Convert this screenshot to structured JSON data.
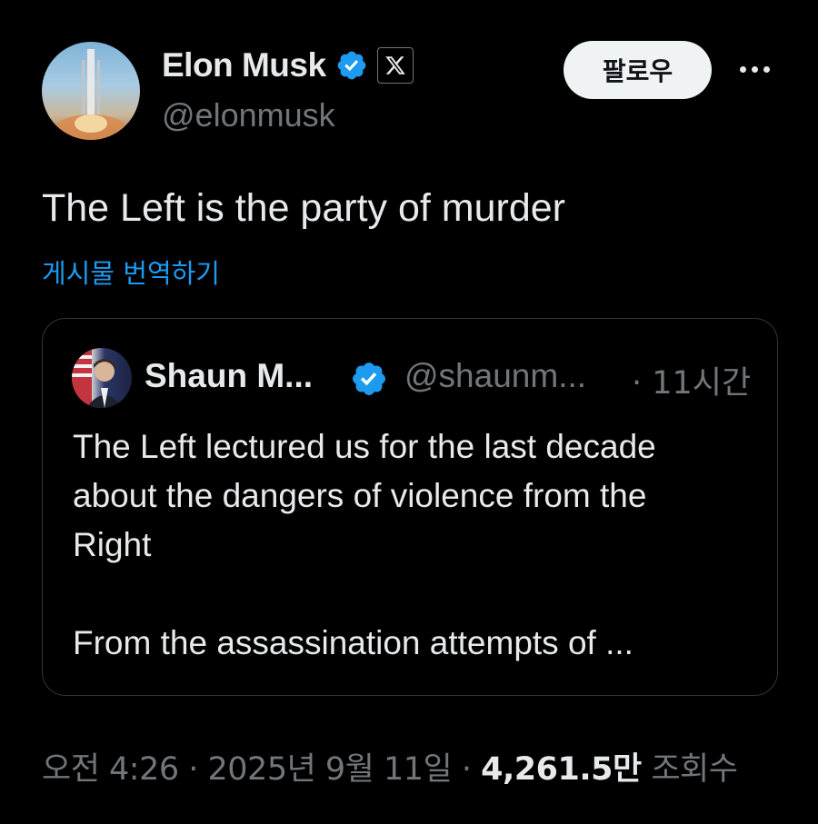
{
  "author": {
    "name": "Elon Musk",
    "handle": "@elonmusk",
    "verified_color": "#1d9bf0"
  },
  "actions": {
    "follow_label": "팔로우"
  },
  "tweet": {
    "text": "The Left is the party of murder",
    "translate_label": "게시물 번역하기"
  },
  "quoted": {
    "name": "Shaun M...",
    "handle": "@shaunm...",
    "time": "· 11시간",
    "lines": [
      "The Left lectured us for the last decade",
      "about the dangers of violence from the",
      "Right"
    ],
    "second_paragraph": "From the assassination attempts of ..."
  },
  "meta": {
    "time": "오전 4:26",
    "separator": " · ",
    "date": "2025년 9월 11일",
    "views_count": "4,261.5만",
    "views_label": "조회수"
  },
  "icons": {
    "verified": "verified-badge-icon",
    "x_logo": "x-logo-icon",
    "more": "more-dots-icon"
  }
}
